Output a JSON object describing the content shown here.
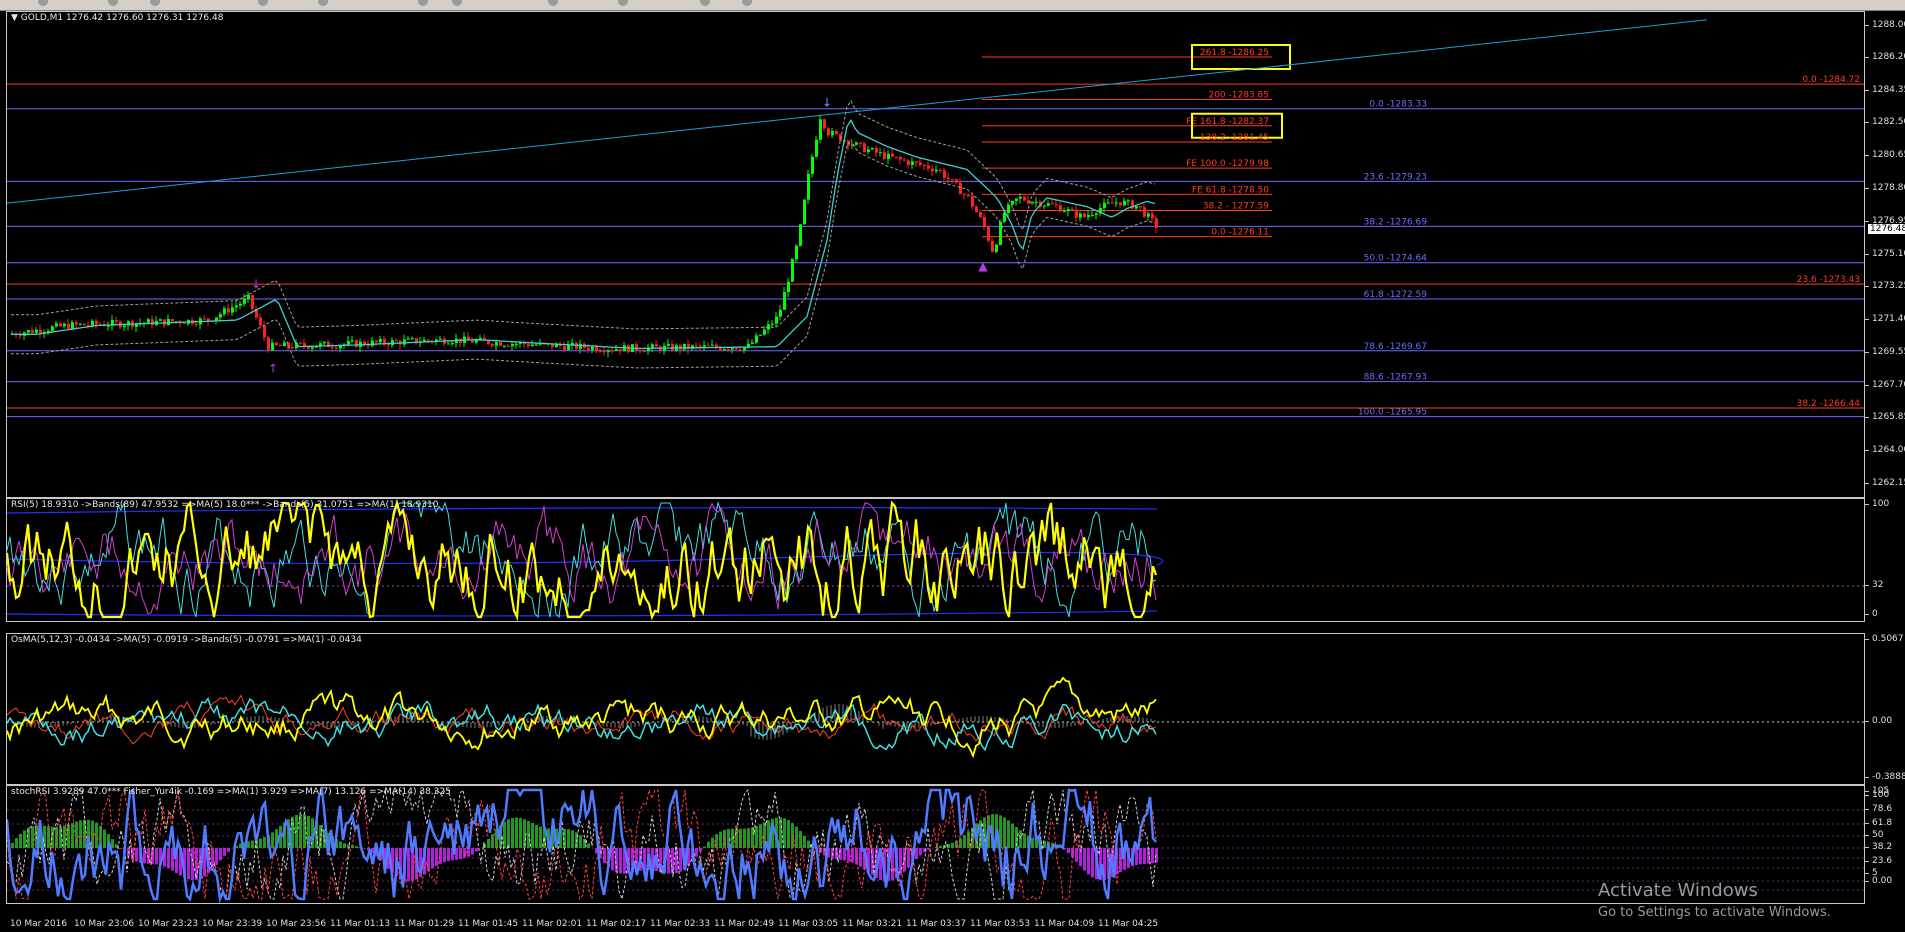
{
  "colors": {
    "background": "#000000",
    "bull_candle": "#00ff00",
    "bear_candle": "#ff2020",
    "fib_blue": "#6b6bff",
    "fib_red": "#ff3b1f",
    "trend_line": "#1e9fd8",
    "highlight_box": "#ffff00",
    "rsi_line": "#ffff00",
    "bands": "#2030ff",
    "stoch_line": "#4f7cff",
    "hist_green": "#1f9a1f",
    "hist_magenta": "#b21ee0"
  },
  "main": {
    "title": "GOLD,M1  1276.42 1276.60 1276.31 1276.48",
    "current_price": "1276.48",
    "price_ticks": [
      "1288.00",
      "1286.20",
      "1284.35",
      "1282.50",
      "1280.65",
      "1278.80",
      "1276.95",
      "1275.10",
      "1273.25",
      "1271.40",
      "1269.55",
      "1267.70",
      "1265.85",
      "1264.00",
      "1262.15"
    ],
    "fib_blue_labels": [
      "0.0 -1283.33",
      "23.6 -1279.23",
      "38.2 -1276.69",
      "50.0 -1274.64",
      "61.8 -1272.59",
      "78.6 -1269.67",
      "88.6 -1267.93",
      "100.0 -1265.95"
    ],
    "fib_red_labels": [
      "261.8 -1286.25",
      "200 -1283.85",
      "FE 161.8 -1282.37",
      "138.2 -1281.45",
      "FE 100.0 -1279.98",
      "FE 61.8 -1278.50",
      "38.2 - 1277.59",
      "0.0 -1276.11"
    ],
    "fib_far_labels": [
      "0.0 -1284.72",
      "23.6 -1273.43",
      "38.2 -1266.44"
    ]
  },
  "rsi": {
    "title": "RSI(5) 18.9310  ->Bands(89) 47.9532  =>MA(5) 18.0***  ->Bands(5) 31.0751  =>MA(1) 18.9310",
    "ticks": [
      "100",
      "32",
      "0"
    ]
  },
  "osma": {
    "title": "OsMA(5,12,3) -0.0434  ->MA(5) -0.0919  ->Bands(5) -0.0791  =>MA(1) -0.0434",
    "ticks": [
      "0.5067",
      "0.00",
      "-0.3888"
    ]
  },
  "stoch": {
    "title": "stochRSI 3.9289 47.0*** Fisher_Yur4ik -0.169  =>MA(1) 3.929  =>MA(7) 13.126  =>MA(14) 38.325",
    "ticks": [
      "105",
      "100",
      "78.6",
      "61.8",
      "50",
      "38.2",
      "23.6",
      "5",
      "0.00"
    ]
  },
  "time_labels": [
    "10 Mar 2016",
    "10 Mar 23:06",
    "10 Mar 23:23",
    "10 Mar 23:39",
    "10 Mar 23:56",
    "11 Mar 01:13",
    "11 Mar 01:29",
    "11 Mar 01:45",
    "11 Mar 02:01",
    "11 Mar 02:17",
    "11 Mar 02:33",
    "11 Mar 02:49",
    "11 Mar 03:05",
    "11 Mar 03:21",
    "11 Mar 03:37",
    "11 Mar 03:53",
    "11 Mar 04:09",
    "11 Mar 04:25"
  ],
  "watermark": {
    "line1": "Activate Windows",
    "line2": "Go to Settings to activate Windows."
  }
}
